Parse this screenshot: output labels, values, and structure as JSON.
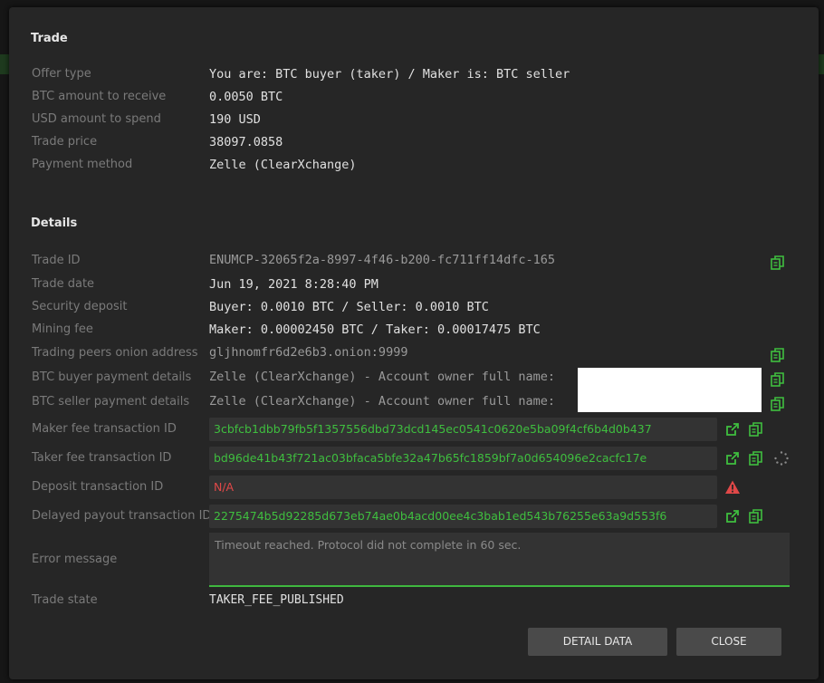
{
  "trade_section": {
    "title": "Trade",
    "offer_type": {
      "label": "Offer type",
      "value": "You are: BTC buyer (taker) / Maker is: BTC seller"
    },
    "btc_amount": {
      "label": "BTC amount to receive",
      "value": "0.0050 BTC"
    },
    "usd_amount": {
      "label": "USD amount to spend",
      "value": "190 USD"
    },
    "trade_price": {
      "label": "Trade price",
      "value": "38097.0858"
    },
    "payment_method": {
      "label": "Payment method",
      "value": "Zelle (ClearXchange)"
    }
  },
  "details_section": {
    "title": "Details",
    "trade_id": {
      "label": "Trade ID",
      "value": "ENUMCP-32065f2a-8997-4f46-b200-fc711ff14dfc-165"
    },
    "trade_date": {
      "label": "Trade date",
      "value": "Jun 19, 2021 8:28:40 PM"
    },
    "security_deposit": {
      "label": "Security deposit",
      "value": "Buyer: 0.0010 BTC / Seller: 0.0010 BTC"
    },
    "mining_fee": {
      "label": "Mining fee",
      "value": "Maker: 0.00002450 BTC / Taker: 0.00017475 BTC"
    },
    "peers_onion": {
      "label": "Trading peers onion address",
      "value": "gljhnomfr6d2e6b3.onion:9999"
    },
    "buyer_payment": {
      "label": "BTC buyer payment details",
      "value": "Zelle (ClearXchange) - Account owner full name: "
    },
    "seller_payment": {
      "label": "BTC seller payment details",
      "value": "Zelle (ClearXchange) - Account owner full name: "
    },
    "maker_fee_tx": {
      "label": "Maker fee transaction ID",
      "value": "3cbfcb1dbb79fb5f1357556dbd73dcd145ec0541c0620e5ba09f4cf6b4d0b437"
    },
    "taker_fee_tx": {
      "label": "Taker fee transaction ID",
      "value": "bd96de41b43f721ac03bfaca5bfe32a47b65fc1859bf7a0d654096e2cacfc17e"
    },
    "deposit_tx": {
      "label": "Deposit transaction ID",
      "value": "N/A"
    },
    "delayed_payout_tx": {
      "label": "Delayed payout transaction ID",
      "value": "2275474b5d92285d673eb74ae0b4acd00ee4c3bab1ed543b76255e63a9d553f6"
    },
    "error_message": {
      "label": "Error message",
      "value": "Timeout reached. Protocol did not complete in 60 sec."
    },
    "trade_state": {
      "label": "Trade state",
      "value": "TAKER_FEE_PUBLISHED"
    }
  },
  "buttons": {
    "detail_data": "DETAIL DATA",
    "close": "CLOSE"
  },
  "icons": {
    "copy": "copy-icon",
    "external_link": "external-link-icon",
    "warning": "warning-icon",
    "spinner": "spinner-icon"
  },
  "colors": {
    "accent_green": "#3fbf3f",
    "error_red": "#e04848"
  }
}
